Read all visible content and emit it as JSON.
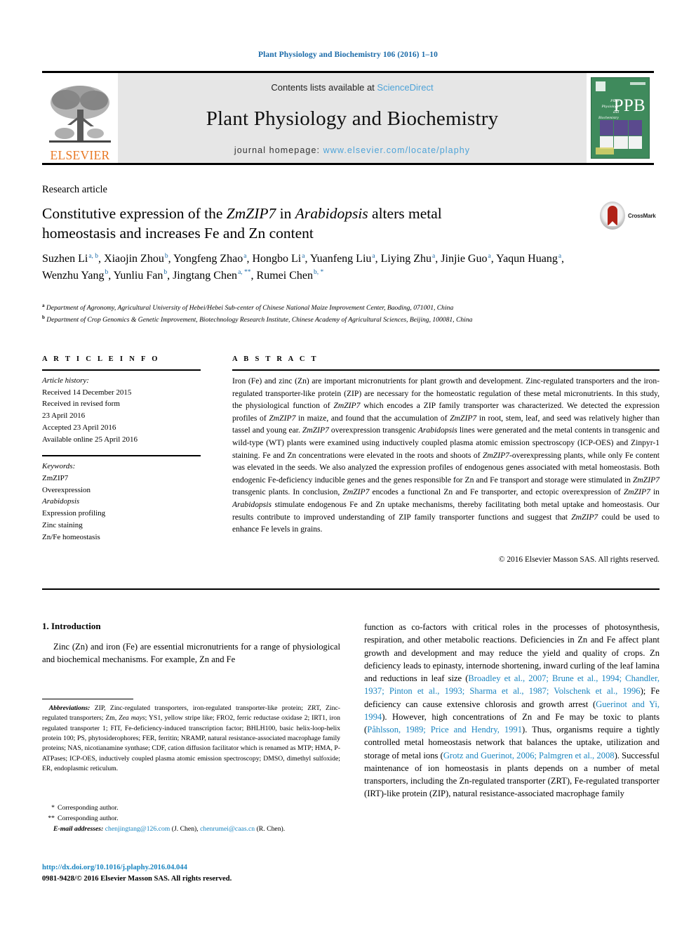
{
  "running_head": "Plant Physiology and Biochemistry 106 (2016) 1–10",
  "banner": {
    "contents_prefix": "Contents lists available at ",
    "contents_link": "ScienceDirect",
    "journal_title": "Plant Physiology and Biochemistry",
    "homepage_prefix": "journal homepage: ",
    "homepage_link": "www.elsevier.com/locate/plaphy",
    "publisher_wordmark": "ELSEVIER",
    "cover_letters": "PPB",
    "cover_sublabel": "Plant Physiology and Biochemistry"
  },
  "article": {
    "type": "Research article",
    "title_line1_a": "Constitutive expression of the ",
    "title_line1_b": "ZmZIP7",
    "title_line1_c": " in ",
    "title_line1_d": "Arabidopsis",
    "title_line1_e": " alters metal",
    "title_line2": "homeostasis and increases Fe and Zn content",
    "crossmark_label": "CrossMark"
  },
  "authors": [
    {
      "name": "Suzhen Li",
      "marks": "a, b",
      "sep": ", "
    },
    {
      "name": "Xiaojin Zhou",
      "marks": "b",
      "sep": ", "
    },
    {
      "name": "Yongfeng Zhao",
      "marks": "a",
      "sep": ", "
    },
    {
      "name": "Hongbo Li",
      "marks": "a",
      "sep": ", "
    },
    {
      "name": "Yuanfeng Liu",
      "marks": "a",
      "sep": ", "
    },
    {
      "name": "Liying Zhu",
      "marks": "a",
      "sep": ", "
    },
    {
      "name": "Jinjie Guo",
      "marks": "a",
      "sep": ", "
    },
    {
      "name": "Yaqun Huang",
      "marks": "a",
      "sep": ", "
    },
    {
      "name": "Wenzhu Yang",
      "marks": "b",
      "sep": ", "
    },
    {
      "name": "Yunliu Fan",
      "marks": "b",
      "sep": ", "
    },
    {
      "name": "Jingtang Chen",
      "marks": "a, **",
      "sep": ", "
    },
    {
      "name": "Rumei Chen",
      "marks": "b, *",
      "sep": ""
    }
  ],
  "affiliations": [
    {
      "mark": "a",
      "text": "Department of Agronomy, Agricultural University of Hebei/Hebei Sub-center of Chinese National Maize Improvement Center, Baoding, 071001, China"
    },
    {
      "mark": "b",
      "text": "Department of Crop Genomics & Genetic Improvement, Biotechnology Research Institute, Chinese Academy of Agricultural Sciences, Beijing, 100081, China"
    }
  ],
  "headers": {
    "article_info": "A R T I C L E  I N F O",
    "abstract": "A B S T R A C T"
  },
  "article_info": {
    "history_label": "Article history:",
    "history": [
      "Received 14 December 2015",
      "Received in revised form",
      "23 April 2016",
      "Accepted 23 April 2016",
      "Available online 25 April 2016"
    ],
    "keywords_label": "Keywords:",
    "keywords": [
      "ZmZIP7",
      "Overexpression",
      "Arabidopsis",
      "Expression profiling",
      "Zinc staining",
      "Zn/Fe homeostasis"
    ],
    "italic_keywords": [
      "Arabidopsis"
    ]
  },
  "abstract": {
    "paragraph": "Iron (Fe) and zinc (Zn) are important micronutrients for plant growth and development. Zinc-regulated transporters and the iron-regulated transporter-like protein (ZIP) are necessary for the homeostatic regulation of these metal micronutrients. In this study, the physiological function of @ZmZIP7@ which encodes a ZIP family transporter was characterized. We detected the expression profiles of @ZmZIP7@ in maize, and found that the accumulation of @ZmZIP7@ in root, stem, leaf, and seed was relatively higher than tassel and young ear. @ZmZIP7@ overexpression transgenic @Arabidopsis@ lines were generated and the metal contents in transgenic and wild-type (WT) plants were examined using inductively coupled plasma atomic emission spectroscopy (ICP-OES) and Zinpyr-1 staining. Fe and Zn concentrations were elevated in the roots and shoots of @ZmZIP7@-overexpressing plants, while only Fe content was elevated in the seeds. We also analyzed the expression profiles of endogenous genes associated with metal homeostasis. Both endogenic Fe-deficiency inducible genes and the genes responsible for Zn and Fe transport and storage were stimulated in @ZmZIP7@ transgenic plants. In conclusion, @ZmZIP7@ encodes a functional Zn and Fe transporter, and ectopic overexpression of @ZmZIP7@ in @Arabidopsis@ stimulate endogenous Fe and Zn uptake mechanisms, thereby facilitating both metal uptake and homeostasis. Our results contribute to improved understanding of ZIP family transporter functions and suggest that @ZmZIP7@ could be used to enhance Fe levels in grains.",
    "copyright": "© 2016 Elsevier Masson SAS. All rights reserved."
  },
  "introduction": {
    "heading": "1. Introduction",
    "left_paragraph": "Zinc (Zn) and iron (Fe) are essential micronutrients for a range of physiological and biochemical mechanisms. For example, Zn and Fe",
    "right_paragraph_parts": [
      {
        "t": "function as co-factors with critical roles in the processes of photosynthesis, respiration, and other metabolic reactions. Deficiencies in Zn and Fe affect plant growth and development and may reduce the yield and quality of crops. Zn deficiency leads to epinasty, internode shortening, inward curling of the leaf lamina and reductions in leaf size (",
        "link": false
      },
      {
        "t": "Broadley et al., 2007; Brune et al., 1994; Chandler, 1937; Pinton et al., 1993; Sharma et al., 1987; Volschenk et al., 1996",
        "link": true
      },
      {
        "t": "); Fe deficiency can cause extensive chlorosis and growth arrest (",
        "link": false
      },
      {
        "t": "Guerinot and Yi, 1994",
        "link": true
      },
      {
        "t": "). However, high concentrations of Zn and Fe may be toxic to plants (",
        "link": false
      },
      {
        "t": "Påhlsson, 1989; Price and Hendry, 1991",
        "link": true
      },
      {
        "t": "). Thus, organisms require a tightly controlled metal homeostasis network that balances the uptake, utilization and storage of metal ions (",
        "link": false
      },
      {
        "t": "Grotz and Guerinot, 2006; Palmgren et al., 2008",
        "link": true
      },
      {
        "t": "). Successful maintenance of ion homeostasis in plants depends on a number of metal transporters, including the Zn-regulated transporter (ZRT), Fe-regulated transporter (IRT)-like protein (ZIP), natural resistance-associated macrophage family",
        "link": false
      }
    ]
  },
  "footnotes": {
    "abbr_label": "Abbreviations:",
    "abbr_text_parts": [
      {
        "t": " ZIP, Zinc-regulated transporters, iron-regulated transporter-like protein; ZRT, Zinc-regulated transporters; Zm, ",
        "italic": false
      },
      {
        "t": "Zea mays",
        "italic": true
      },
      {
        "t": "; YS1, yellow stripe like; FRO2, ferric reductase oxidase 2; IRT1, iron regulated transporter 1; FIT, Fe-deficiency-induced transcription factor; BHLH100, basic helix-loop-helix protein 100; PS, phytosiderophores; FER, ferritin; NRAMP, natural resistance-associated macrophage family proteins; NAS, nicotianamine synthase; CDF, cation diffusion facilitator which is renamed as MTP; HMA, P-ATPases; ICP-OES, inductively coupled plasma atomic emission spectroscopy; DMSO, dimethyl sulfoxide; ER, endoplasmic reticulum.",
        "italic": false
      }
    ],
    "corresponding_single": "Corresponding author.",
    "corresponding_double": "Corresponding author.",
    "email_label": "E-mail addresses:",
    "email1": "chenjingtang@126.com",
    "email1_owner": "(J. Chen)",
    "email2": "chenrumei@caas.cn",
    "email2_owner": "(R. Chen)."
  },
  "footer": {
    "doi": "http://dx.doi.org/10.1016/j.plaphy.2016.04.044",
    "issn_line": "0981-9428/© 2016 Elsevier Masson SAS. All rights reserved."
  },
  "colors": {
    "link_blue": "#1a85c0",
    "header_blue": "#1a6aa8",
    "elsevier_orange": "#E87722",
    "banner_grey": "#e6e6e6",
    "cover_green": "#3f8a5c",
    "crossmark_red": "#b02318"
  }
}
